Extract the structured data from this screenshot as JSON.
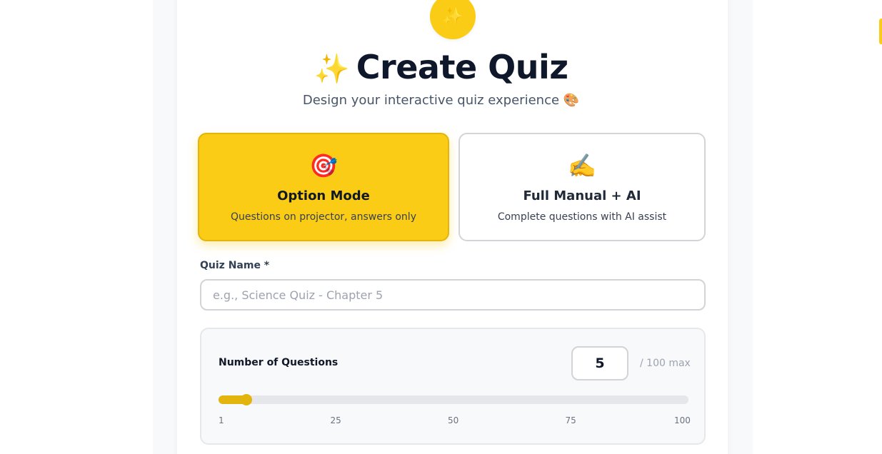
{
  "header": {
    "badge_icon": "✨",
    "title_icon": "✨",
    "title": "Create Quiz",
    "subtitle": "Design your interactive quiz experience 🎨"
  },
  "modes": [
    {
      "icon": "🎯",
      "title": "Option Mode",
      "description": "Questions on projector, answers only",
      "selected": true
    },
    {
      "icon": "✍️",
      "title": "Full Manual + AI",
      "description": "Complete questions with AI assist",
      "selected": false
    }
  ],
  "quiz_name": {
    "label": "Quiz Name *",
    "value": "",
    "placeholder": "e.g., Science Quiz - Chapter 5"
  },
  "questions": {
    "label": "Number of Questions",
    "value": "5",
    "max_label": "/ 100 max",
    "slider_min": 1,
    "slider_max": 100,
    "slider_value": 5,
    "ticks": [
      "1",
      "25",
      "50",
      "75",
      "100"
    ]
  },
  "colors": {
    "accent": "#facc15",
    "accent_dark": "#e3b40e",
    "title": "#0f172a"
  }
}
